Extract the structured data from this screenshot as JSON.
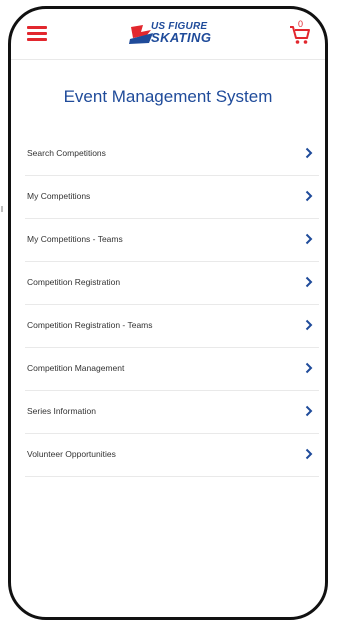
{
  "header": {
    "menu_icon": "hamburger-icon",
    "logo": {
      "line1": "US FIGURE",
      "line2": "SKATING"
    },
    "cart_icon": "cart-icon",
    "cart_count": "0"
  },
  "page": {
    "title": "Event Management System"
  },
  "menu": {
    "items": [
      {
        "label": "Search Competitions"
      },
      {
        "label": "My Competitions"
      },
      {
        "label": "My Competitions - Teams"
      },
      {
        "label": "Competition Registration"
      },
      {
        "label": "Competition Registration - Teams"
      },
      {
        "label": "Competition Management"
      },
      {
        "label": "Series Information"
      },
      {
        "label": "Volunteer Opportunities"
      }
    ]
  },
  "colors": {
    "accent_red": "#e2272e",
    "brand_blue": "#1f4b9a"
  }
}
